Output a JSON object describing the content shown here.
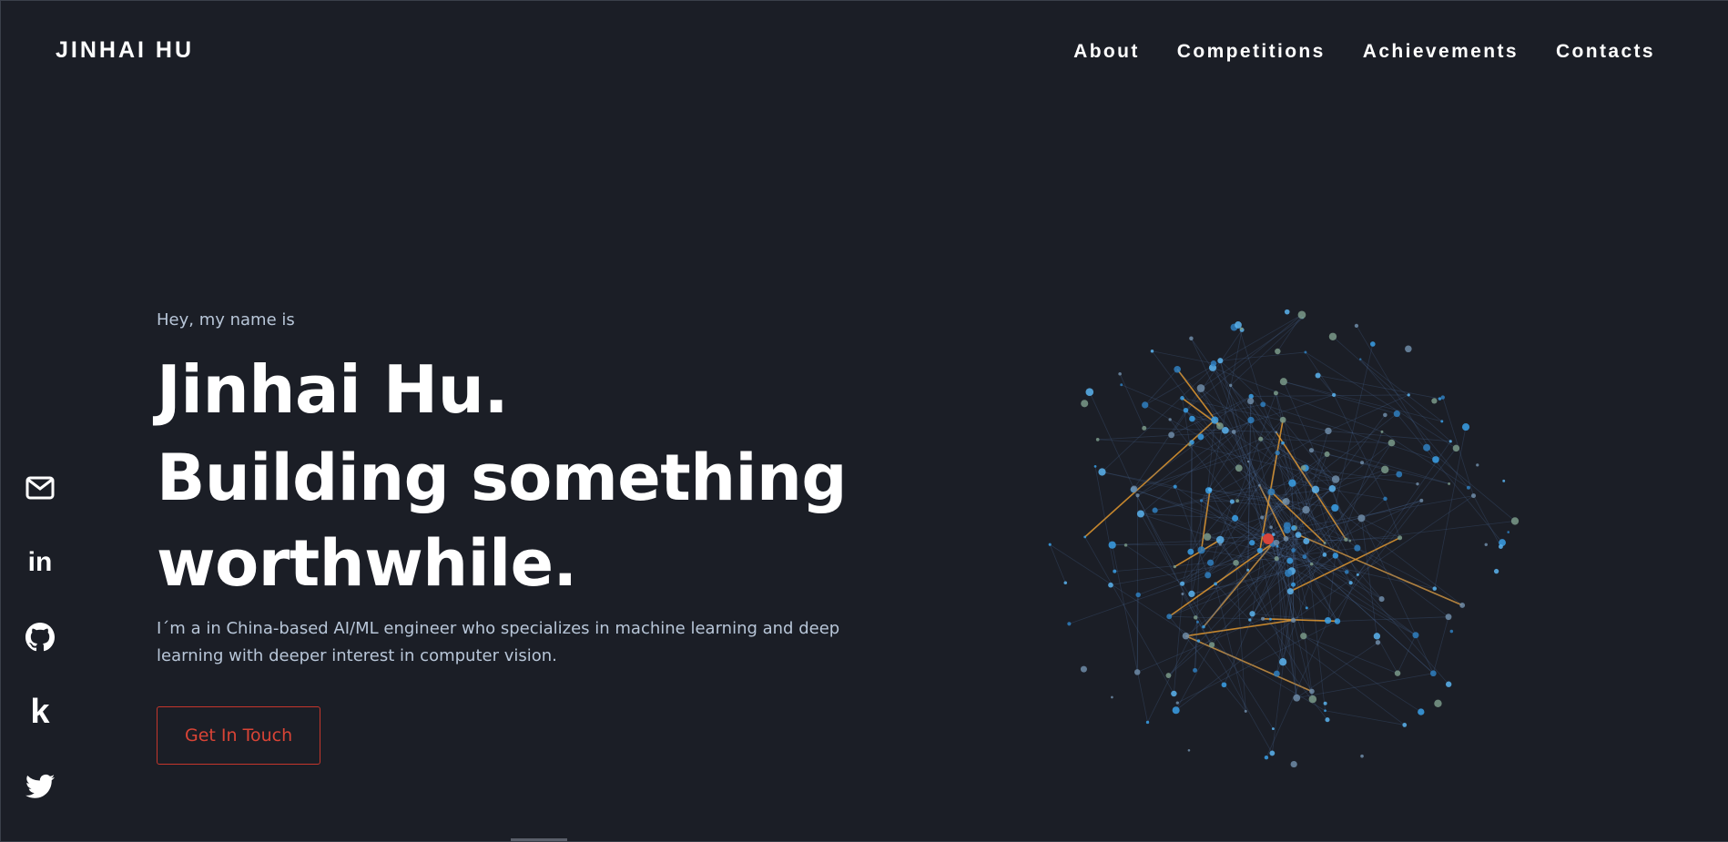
{
  "brand": "JINHAI HU",
  "nav": {
    "items": [
      {
        "label": "About"
      },
      {
        "label": "Competitions"
      },
      {
        "label": "Achievements"
      },
      {
        "label": "Contacts"
      }
    ]
  },
  "hero": {
    "intro": "Hey, my name is",
    "name": "Jinhai Hu.",
    "headline": "Building something worthwhile.",
    "description": "I´m a in China-based AI/ML engineer who specializes in machine learning and deep learning with deeper interest in computer vision.",
    "cta_label": "Get In Touch"
  },
  "social": [
    {
      "icon": "mail-icon"
    },
    {
      "icon": "linkedin-icon",
      "glyph": "in"
    },
    {
      "icon": "github-icon"
    },
    {
      "icon": "kaggle-icon",
      "glyph": "k"
    },
    {
      "icon": "twitter-icon"
    }
  ],
  "colors": {
    "background": "#1b1e26",
    "accent": "#d94436",
    "muted_text": "#b8c6d8",
    "node_blue": "#3aa0e8",
    "edge_orange": "#f0a030"
  }
}
